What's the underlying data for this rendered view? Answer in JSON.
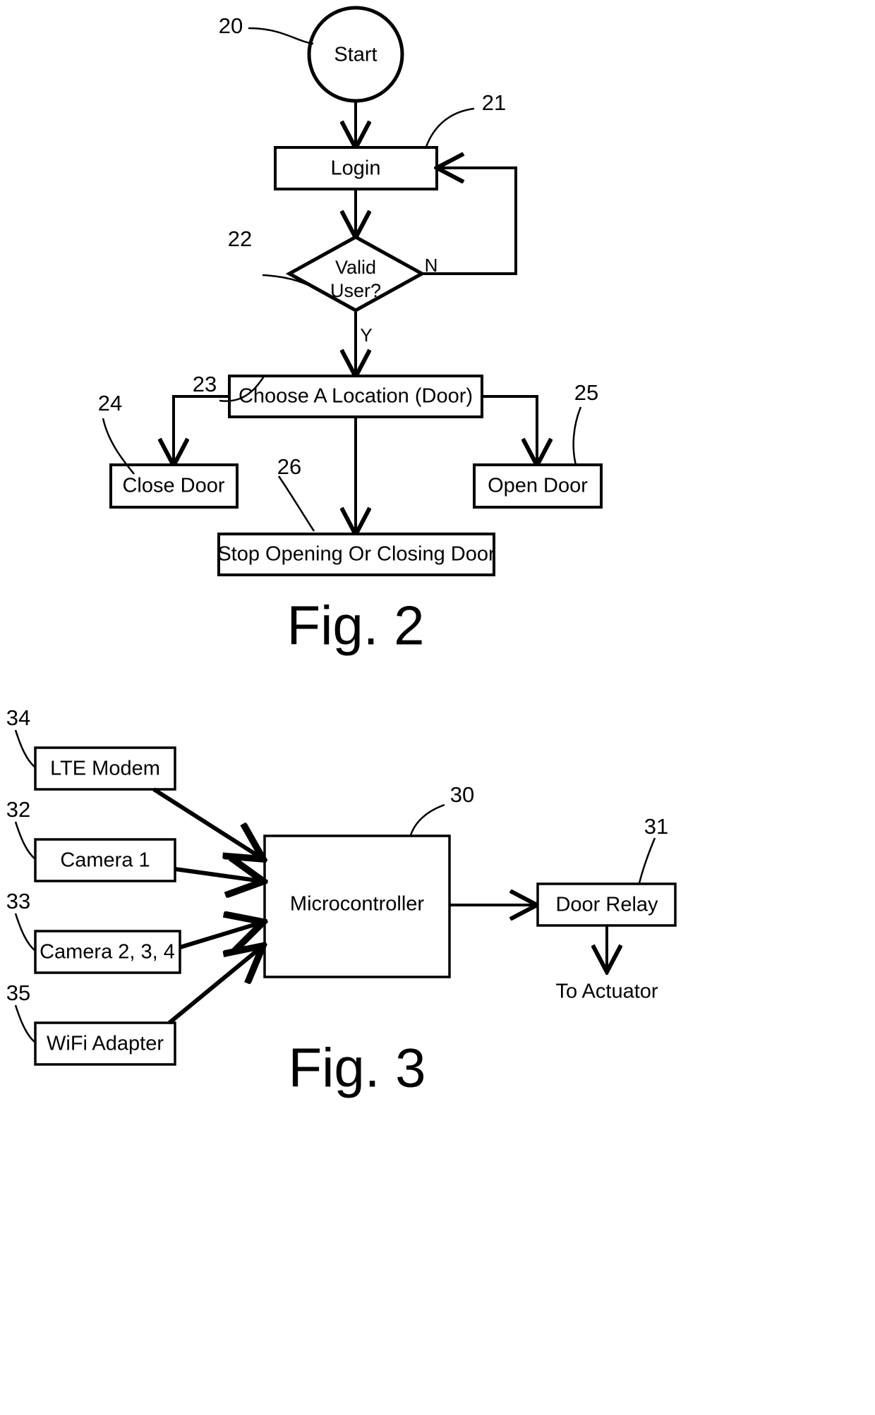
{
  "figures": [
    {
      "id": "fig2",
      "caption": "Fig. 2",
      "nodes": {
        "start": {
          "label": "Start",
          "ref": "20"
        },
        "login": {
          "label": "Login",
          "ref": "21"
        },
        "valid_user": {
          "label_line1": "Valid",
          "label_line2": "User?",
          "ref": "22"
        },
        "choose_location": {
          "label": "Choose A Location (Door)",
          "ref": "23"
        },
        "close_door": {
          "label": "Close Door",
          "ref": "24"
        },
        "open_door": {
          "label": "Open Door",
          "ref": "25"
        },
        "stop_door": {
          "label": "Stop Opening Or Closing Door",
          "ref": "26"
        }
      },
      "branch_labels": {
        "no": "N",
        "yes": "Y"
      }
    },
    {
      "id": "fig3",
      "caption": "Fig. 3",
      "nodes": {
        "lte_modem": {
          "label": "LTE Modem",
          "ref": "34"
        },
        "camera1": {
          "label": "Camera 1",
          "ref": "32"
        },
        "camera234": {
          "label": "Camera 2, 3, 4",
          "ref": "33"
        },
        "wifi_adapter": {
          "label": "WiFi Adapter",
          "ref": "35"
        },
        "microcontroller": {
          "label": "Microcontroller",
          "ref": "30"
        },
        "door_relay": {
          "label": "Door Relay",
          "ref": "31"
        },
        "to_actuator": {
          "label": "To Actuator"
        }
      }
    }
  ],
  "colors": {
    "ink": "#000000",
    "paper": "#ffffff"
  }
}
